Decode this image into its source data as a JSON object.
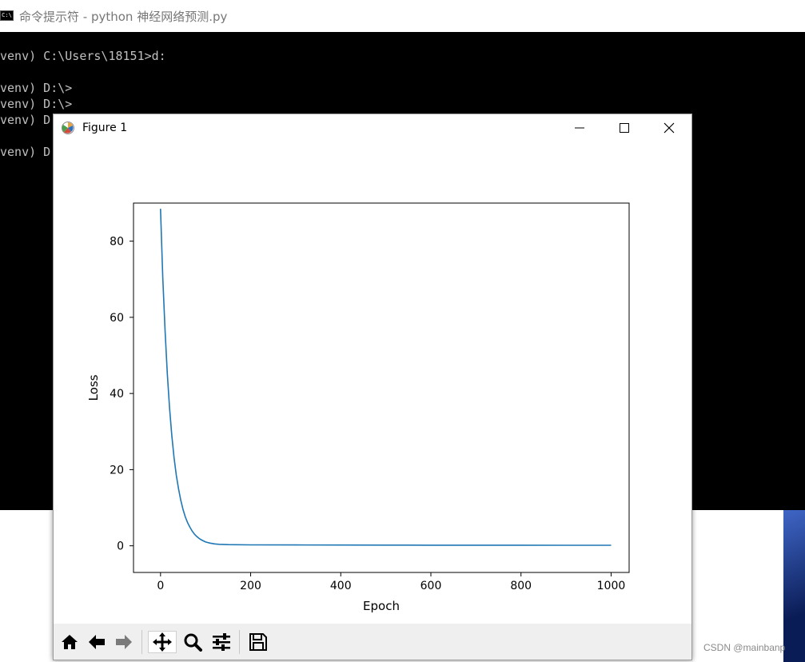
{
  "console": {
    "title": "命令提示符 - python  神经网络预测.py",
    "icon_label": "C:\\",
    "lines": [
      "venv) C:\\Users\\18151>d:",
      "venv) D:\\>",
      "venv) D:\\>",
      "venv) D",
      "venv) D"
    ]
  },
  "figure_window": {
    "title": "Figure 1",
    "icon": "matplotlib-icon",
    "controls": {
      "minimize_icon": "minimize-icon",
      "maximize_icon": "maximize-icon",
      "close_icon": "close-icon"
    }
  },
  "toolbar": {
    "items": [
      "home-icon",
      "back-icon",
      "forward-icon",
      "pan-icon",
      "zoom-icon",
      "configure-subplots-icon",
      "save-icon"
    ],
    "active": "pan-icon"
  },
  "watermark": "CSDN @mainbanp",
  "colors": {
    "line": "#1f77b4",
    "console_bg": "#000000",
    "toolbar_bg": "#efefef"
  },
  "chart_data": {
    "type": "line",
    "title": "",
    "xlabel": "Epoch",
    "ylabel": "Loss",
    "xlim": [
      -60,
      1040
    ],
    "ylim": [
      -7,
      90
    ],
    "xticks": [
      0,
      200,
      400,
      600,
      800,
      1000
    ],
    "yticks": [
      0,
      20,
      40,
      60,
      80
    ],
    "grid": false,
    "series": [
      {
        "x": [
          0,
          5,
          10,
          15,
          20,
          25,
          30,
          35,
          40,
          45,
          50,
          55,
          60,
          65,
          70,
          75,
          80,
          85,
          90,
          95,
          100,
          110,
          120,
          130,
          150,
          200,
          300,
          400,
          500,
          600,
          700,
          800,
          900,
          1000
        ],
        "y": [
          88.5,
          70.5,
          56.5,
          45.2,
          36.2,
          29.0,
          23.2,
          18.6,
          14.9,
          11.9,
          9.5,
          7.6,
          6.1,
          4.9,
          3.9,
          3.1,
          2.5,
          2.0,
          1.6,
          1.3,
          1.0,
          0.7,
          0.5,
          0.4,
          0.3,
          0.25,
          0.22,
          0.2,
          0.18,
          0.17,
          0.16,
          0.15,
          0.14,
          0.13
        ]
      }
    ]
  }
}
